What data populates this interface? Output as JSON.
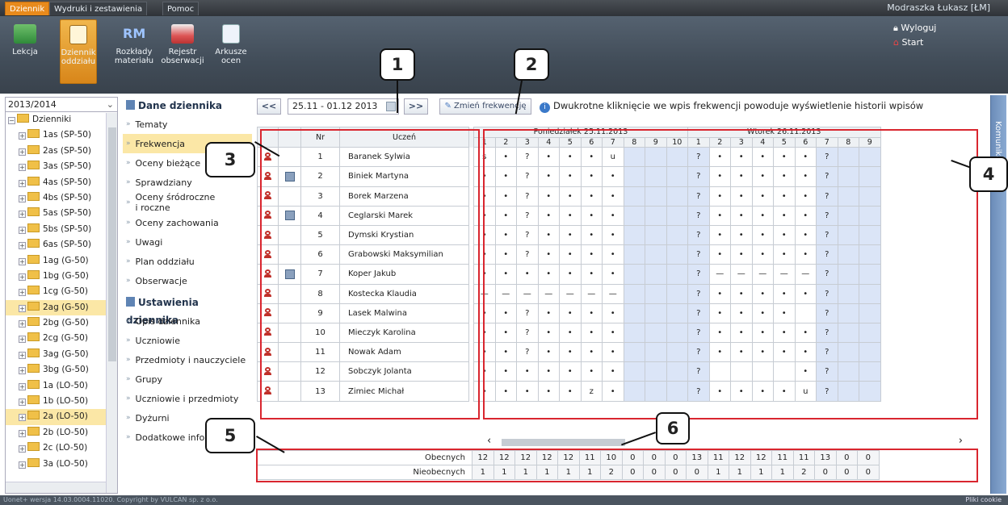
{
  "menu": {
    "tabs": [
      "Dziennik",
      "Wydruki i zestawienia",
      "Pomoc"
    ],
    "user": "Modraszka Łukasz [ŁM]"
  },
  "ribbon": {
    "buttons": [
      [
        "Lekcja",
        ""
      ],
      [
        "Dziennik",
        "oddziału"
      ],
      [
        "Rozkłady",
        "materiału"
      ],
      [
        "Rejestr",
        "obserwacji"
      ],
      [
        "Arkusze",
        "ocen"
      ]
    ],
    "rm_icon_text": "RM",
    "logout": "Wyloguj",
    "start": "Start"
  },
  "tree": {
    "year": "2013/2014",
    "root": "Dzienniki",
    "items": [
      "1as (SP-50)",
      "2as (SP-50)",
      "3as (SP-50)",
      "4as (SP-50)",
      "4bs (SP-50)",
      "5as (SP-50)",
      "5bs (SP-50)",
      "6as (SP-50)",
      "1ag (G-50)",
      "1bg (G-50)",
      "1cg (G-50)",
      "2ag (G-50)",
      "2bg (G-50)",
      "2cg (G-50)",
      "3ag (G-50)",
      "3bg (G-50)",
      "1a (LO-50)",
      "1b (LO-50)",
      "2a (LO-50)",
      "2b (LO-50)",
      "2c (LO-50)",
      "3a (LO-50)"
    ]
  },
  "nav": {
    "section1": "Dane dziennika",
    "items1": [
      "Tematy",
      "Frekwencja",
      "Oceny bieżące",
      "Sprawdziany",
      "Oceny śródroczne\ni roczne",
      "Oceny zachowania",
      "Uwagi",
      "Plan oddziału",
      "Obserwacje"
    ],
    "section2": "Ustawienia dziennika",
    "items2": [
      "Opis dziennika",
      "Uczniowie",
      "Przedmioty i nauczyciele",
      "Grupy",
      "Uczniowie i przedmioty",
      "Dyżurni",
      "Dodatkowe informacje"
    ]
  },
  "toolbar": {
    "prev": "<<",
    "range": "25.11 - 01.12 2013",
    "next": ">>",
    "change": "Zmień frekwencję",
    "info": "Dwukrotne kliknięcie we wpis frekwencji powoduje wyświetlenie historii wpisów"
  },
  "grid": {
    "col_nr": "Nr",
    "col_student": "Uczeń",
    "days": [
      "Poniedziałek 25.11.2013",
      "Wtorek 26.11.2013"
    ],
    "mon_lessons": [
      "1",
      "2",
      "3",
      "4",
      "5",
      "6",
      "7",
      "8",
      "9",
      "10"
    ],
    "tue_lessons": [
      "1",
      "2",
      "3",
      "4",
      "5",
      "6",
      "7",
      "8",
      "9"
    ],
    "students": [
      {
        "nr": "1",
        "name": "Baranek Sylwia",
        "card": false,
        "mon": [
          "s",
          "•",
          "?",
          "•",
          "•",
          "•",
          "u",
          "",
          "",
          ""
        ],
        "tue": [
          "?",
          "•",
          "•",
          "•",
          "•",
          "•",
          "?",
          "",
          ""
        ]
      },
      {
        "nr": "2",
        "name": "Biniek Martyna",
        "card": true,
        "mon": [
          "•",
          "•",
          "?",
          "•",
          "•",
          "•",
          "•",
          "",
          "",
          ""
        ],
        "tue": [
          "?",
          "•",
          "•",
          "•",
          "•",
          "•",
          "?",
          "",
          ""
        ]
      },
      {
        "nr": "3",
        "name": "Borek Marzena",
        "card": false,
        "mon": [
          "•",
          "•",
          "?",
          "•",
          "•",
          "•",
          "•",
          "",
          "",
          ""
        ],
        "tue": [
          "?",
          "•",
          "•",
          "•",
          "•",
          "•",
          "?",
          "",
          ""
        ]
      },
      {
        "nr": "4",
        "name": "Ceglarski Marek",
        "card": true,
        "mon": [
          "•",
          "•",
          "?",
          "•",
          "•",
          "•",
          "•",
          "",
          "",
          ""
        ],
        "tue": [
          "?",
          "•",
          "•",
          "•",
          "•",
          "•",
          "?",
          "",
          ""
        ]
      },
      {
        "nr": "5",
        "name": "Dymski Krystian",
        "card": false,
        "mon": [
          "•",
          "•",
          "?",
          "•",
          "•",
          "•",
          "•",
          "",
          "",
          ""
        ],
        "tue": [
          "?",
          "•",
          "•",
          "•",
          "•",
          "•",
          "?",
          "",
          ""
        ]
      },
      {
        "nr": "6",
        "name": "Grabowski Maksymilian",
        "card": false,
        "mon": [
          "•",
          "•",
          "?",
          "•",
          "•",
          "•",
          "•",
          "",
          "",
          ""
        ],
        "tue": [
          "?",
          "•",
          "•",
          "•",
          "•",
          "•",
          "?",
          "",
          ""
        ]
      },
      {
        "nr": "7",
        "name": "Koper Jakub",
        "card": true,
        "mon": [
          "•",
          "•",
          "•",
          "•",
          "•",
          "•",
          "•",
          "",
          "",
          ""
        ],
        "tue": [
          "?",
          "—",
          "—",
          "—",
          "—",
          "—",
          "?",
          "",
          ""
        ]
      },
      {
        "nr": "8",
        "name": "Kostecka Klaudia",
        "card": false,
        "mon": [
          "—",
          "—",
          "—",
          "—",
          "—",
          "—",
          "—",
          "",
          "",
          ""
        ],
        "tue": [
          "?",
          "•",
          "•",
          "•",
          "•",
          "•",
          "?",
          "",
          ""
        ]
      },
      {
        "nr": "9",
        "name": "Lasek Malwina",
        "card": false,
        "mon": [
          "•",
          "•",
          "?",
          "•",
          "•",
          "•",
          "•",
          "",
          "",
          ""
        ],
        "tue": [
          "?",
          "•",
          "•",
          "•",
          "•",
          "",
          "?",
          "",
          ""
        ]
      },
      {
        "nr": "10",
        "name": "Mieczyk Karolina",
        "card": false,
        "mon": [
          "•",
          "•",
          "?",
          "•",
          "•",
          "•",
          "•",
          "",
          "",
          ""
        ],
        "tue": [
          "?",
          "•",
          "•",
          "•",
          "•",
          "•",
          "?",
          "",
          ""
        ]
      },
      {
        "nr": "11",
        "name": "Nowak Adam",
        "card": false,
        "mon": [
          "•",
          "•",
          "?",
          "•",
          "•",
          "•",
          "•",
          "",
          "",
          ""
        ],
        "tue": [
          "?",
          "•",
          "•",
          "•",
          "•",
          "•",
          "?",
          "",
          ""
        ]
      },
      {
        "nr": "12",
        "name": "Sobczyk Jolanta",
        "card": false,
        "mon": [
          "•",
          "•",
          "•",
          "•",
          "•",
          "•",
          "•",
          "",
          "",
          ""
        ],
        "tue": [
          "?",
          "",
          "",
          "",
          "",
          "•",
          "?",
          "",
          ""
        ]
      },
      {
        "nr": "13",
        "name": "Zimiec Michał",
        "card": false,
        "mon": [
          "•",
          "•",
          "•",
          "•",
          "•",
          "z",
          "•",
          "",
          "",
          ""
        ],
        "tue": [
          "?",
          "•",
          "•",
          "•",
          "•",
          "u",
          "?",
          "",
          ""
        ]
      }
    ]
  },
  "summary": {
    "present_label": "Obecnych",
    "absent_label": "Nieobecnych",
    "present": [
      "12",
      "12",
      "12",
      "12",
      "12",
      "11",
      "10",
      "0",
      "0",
      "0",
      "13",
      "11",
      "12",
      "12",
      "11",
      "11",
      "13",
      "0",
      "0"
    ],
    "absent": [
      "1",
      "1",
      "1",
      "1",
      "1",
      "1",
      "2",
      "0",
      "0",
      "0",
      "0",
      "1",
      "1",
      "1",
      "1",
      "2",
      "0",
      "0",
      "0"
    ]
  },
  "callouts": [
    "1",
    "2",
    "3",
    "4",
    "5",
    "6"
  ],
  "right_strip": "Komunikaty",
  "status": {
    "text": "Uonet+ wersja 14.03.0004.11020. Copyright by VULCAN sp. z o.o.",
    "cookies": "Pliki cookie"
  }
}
